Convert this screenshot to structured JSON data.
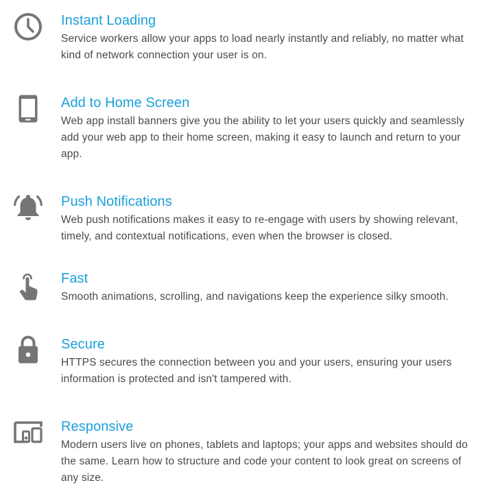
{
  "colors": {
    "title": "#1a9fd9",
    "text": "#4a4a4a",
    "icon": "#757575"
  },
  "features": [
    {
      "icon": "clock-icon",
      "title": "Instant Loading",
      "description": "Service workers allow your apps to load nearly instantly and reliably, no matter what kind of network connection your user is on."
    },
    {
      "icon": "smartphone-icon",
      "title": "Add to Home Screen",
      "description": "Web app install banners give you the ability to let your users quickly and seamlessly add your web app to their home screen, making it easy to launch and return to your app."
    },
    {
      "icon": "bell-icon",
      "title": "Push Notifications",
      "description": "Web push notifications makes it easy to re-engage with users by showing relevant, timely, and contextual notifications, even when the browser is closed."
    },
    {
      "icon": "touch-hand-icon",
      "title": "Fast",
      "description": "Smooth animations, scrolling, and navigations keep the experience silky smooth."
    },
    {
      "icon": "lock-icon",
      "title": "Secure",
      "description": "HTTPS secures the connection between you and your users, ensuring your users information is protected and isn't tampered with."
    },
    {
      "icon": "devices-icon",
      "title": "Responsive",
      "description": "Modern users live on phones, tablets and laptops; your apps and websites should do the same. Learn how to structure and code your content to look great on screens of any size."
    }
  ]
}
